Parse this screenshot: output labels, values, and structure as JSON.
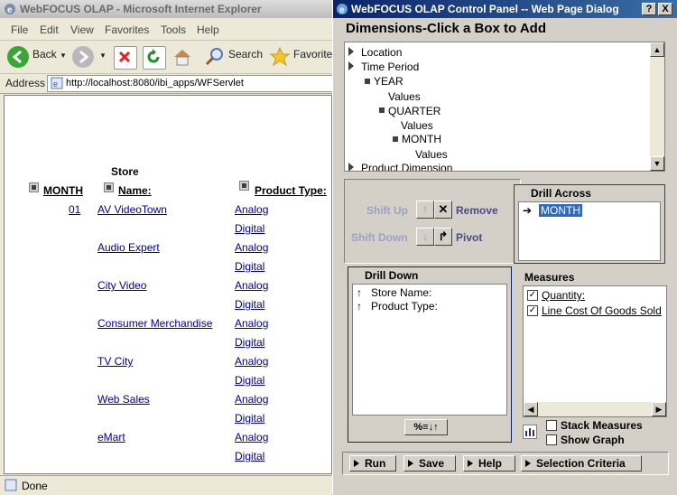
{
  "browser": {
    "title": "WebFOCUS OLAP - Microsoft Internet Explorer",
    "menu": [
      "File",
      "Edit",
      "View",
      "Favorites",
      "Tools",
      "Help"
    ],
    "toolbar": {
      "back": "Back",
      "search": "Search",
      "favorites": "Favorite"
    },
    "address_label": "Address",
    "url": "http://localhost:8080/ibi_apps/WFServlet",
    "status": "Done"
  },
  "report": {
    "headers": {
      "month": "MONTH",
      "store_top": "Store",
      "store_bottom": "Name:",
      "product": "Product Type:"
    },
    "month_value": "01",
    "stores": [
      "AV VideoTown",
      "Audio Expert",
      "City Video",
      "Consumer Merchandise",
      "TV City",
      "Web Sales",
      "eMart"
    ],
    "product_types": [
      "Analog",
      "Digital"
    ]
  },
  "dialog": {
    "title": "WebFOCUS OLAP Control Panel -- Web Page Dialog",
    "help_btn": "?",
    "close_btn": "X",
    "dimensions_heading": "Dimensions-Click a Box to Add",
    "tree": [
      {
        "label": "Location"
      },
      {
        "label": "Time Period"
      },
      {
        "label": "YEAR"
      },
      {
        "label": "Values"
      },
      {
        "label": "QUARTER"
      },
      {
        "label": "Values"
      },
      {
        "label": "MONTH"
      },
      {
        "label": "Values"
      },
      {
        "label": "Product Dimension"
      }
    ],
    "controls": {
      "shift_up": "Shift Up",
      "remove": "Remove",
      "shift_down": "Shift Down",
      "pivot": "Pivot"
    },
    "drill_across": {
      "title": "Drill Across",
      "items": [
        "MONTH"
      ]
    },
    "drill_down": {
      "title": "Drill Down",
      "items": [
        "Store Name:",
        "Product Type:"
      ],
      "sort_btn": "%≡↓↑"
    },
    "measures": {
      "title": "Measures",
      "items": [
        "Quantity:",
        "Line Cost Of Goods Sold"
      ]
    },
    "options": {
      "stack_measures": "Stack Measures",
      "show_graph": "Show Graph"
    },
    "buttons": {
      "run": "Run",
      "save": "Save",
      "help": "Help",
      "selection": "Selection Criteria"
    }
  }
}
